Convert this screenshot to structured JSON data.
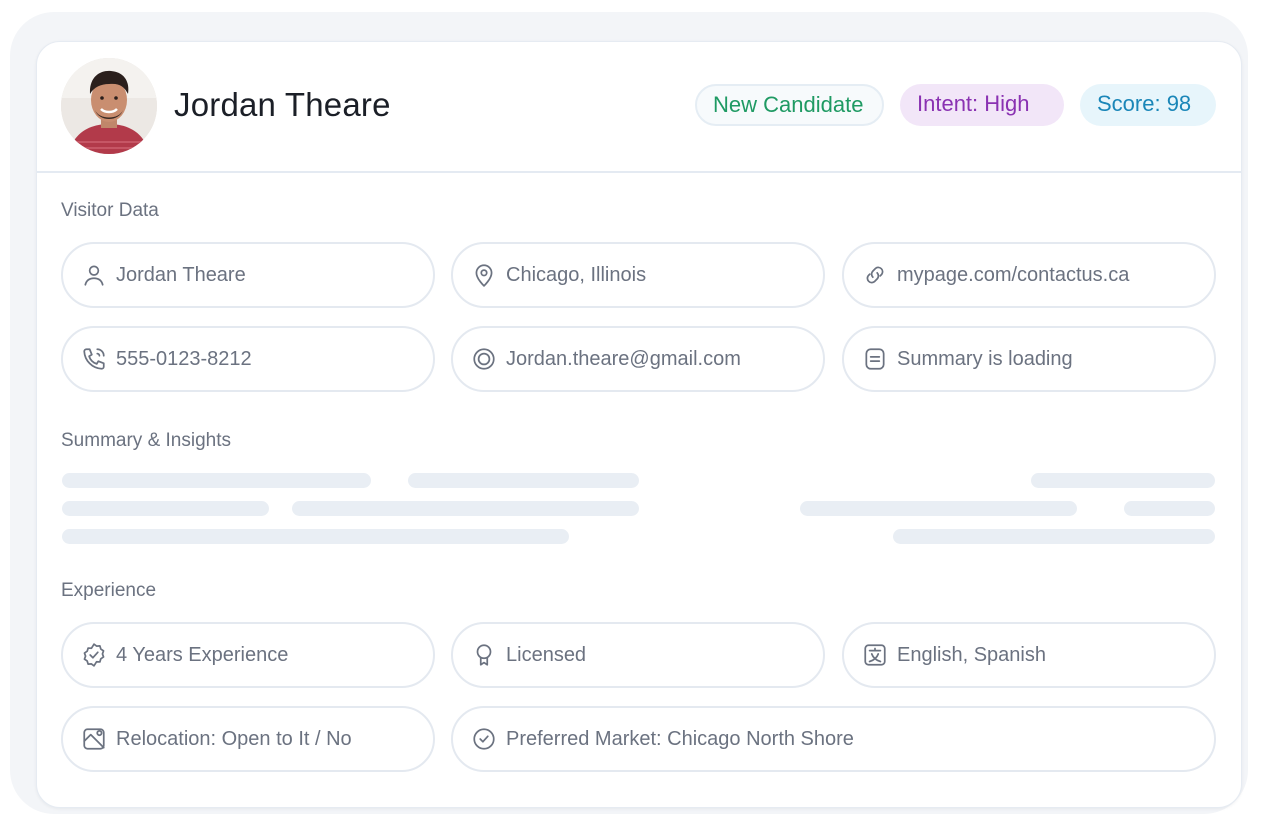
{
  "header": {
    "name": "Jordan Theare",
    "badges": {
      "new": "New Candidate",
      "intent": "Intent: High",
      "score": "Score: 98"
    }
  },
  "visitor": {
    "label": "Visitor Data",
    "name": "Jordan Theare",
    "location": "Chicago, Illinois",
    "url": "mypage.com/contactus.ca",
    "phone": "555-0123-8212",
    "email": "Jordan.theare@gmail.com",
    "summary_status": "Summary is loading"
  },
  "summary": {
    "label": "Summary & Insights"
  },
  "experience": {
    "label": "Experience",
    "years": "4 Years Experience",
    "license": "Licensed",
    "languages": "English, Spanish",
    "relocation": "Relocation: Open to It / No",
    "market": "Preferred Market: Chicago North Shore"
  },
  "icons": {
    "person": "person-icon",
    "location": "location-pin-icon",
    "link": "link-icon",
    "phone": "phone-icon",
    "email": "at-sign-icon",
    "summary": "document-icon",
    "badge": "verified-badge-icon",
    "license": "award-icon",
    "language": "translate-icon",
    "relocation": "map-icon",
    "market": "check-circle-icon"
  },
  "colors": {
    "new_badge_text": "#1f9a63",
    "intent_badge_text": "#8a32b2",
    "intent_badge_bg": "#f2e6f8",
    "score_badge_text": "#1a86b8",
    "score_badge_bg": "#e7f5fb",
    "skeleton": "#e9eef4"
  }
}
